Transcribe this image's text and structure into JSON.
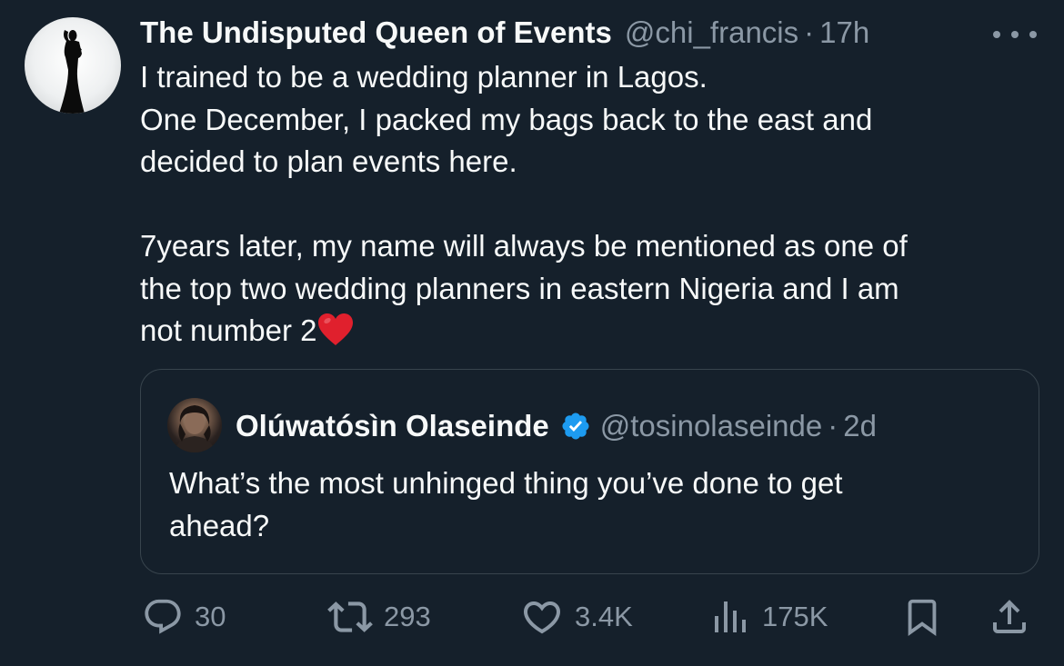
{
  "tweet": {
    "author_name": "The Undisputed Queen of Events",
    "handle": "@chi_francis",
    "separator": "·",
    "time": "17h",
    "text_lines": [
      "I trained to be a wedding planner in Lagos.",
      "One December, I packed my bags back to the east and",
      "decided to plan events here.",
      "",
      "7years later, my name will always be mentioned as one of",
      "the top two wedding planners in eastern Nigeria and I am",
      "not number 2"
    ],
    "emoji": "red-heart-emoji"
  },
  "quote": {
    "author_name": "Olúwatósìn Olaseinde",
    "verified": true,
    "handle": "@tosinolaseinde",
    "separator": "·",
    "time": "2d",
    "text_lines": [
      "What’s the most unhinged thing you’ve done to get",
      "ahead?"
    ]
  },
  "actions": {
    "replies": "30",
    "retweets": "293",
    "likes": "3.4K",
    "views": "175K"
  },
  "icons": {
    "more": "more-horizontal-icon",
    "reply": "reply-bubble-icon",
    "retweet": "retweet-icon",
    "like": "heart-icon",
    "views": "views-bar-chart-icon",
    "bookmark": "bookmark-icon",
    "share": "share-icon",
    "verified": "verified-badge-icon"
  },
  "colors": {
    "background": "#15202b",
    "text": "#f7f9f9",
    "secondary": "#8b98a5",
    "border": "#38444d",
    "verified": "#1d9bf0",
    "heart_emoji": "#e0202d"
  }
}
